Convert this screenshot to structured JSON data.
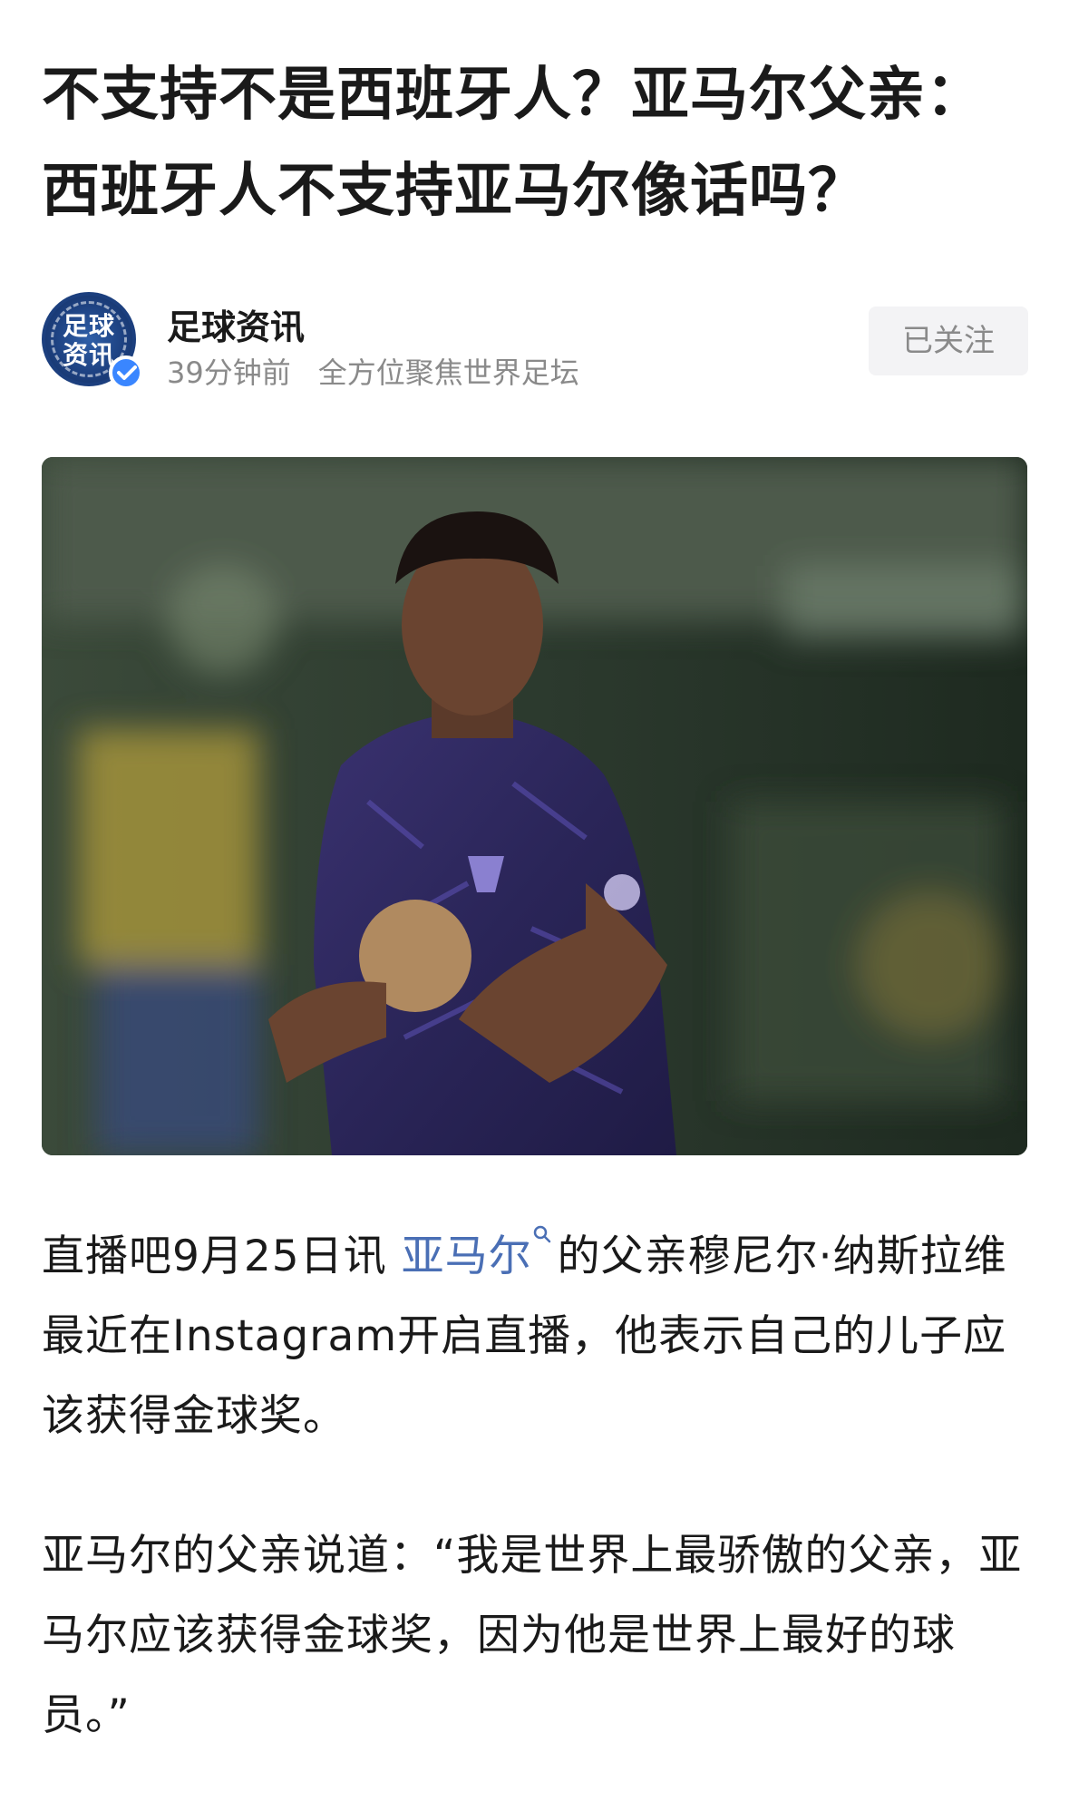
{
  "article": {
    "title": "不支持不是西班牙人？亚马尔父亲：西班牙人不支持亚马尔像话吗？"
  },
  "author": {
    "avatar_text_line1": "足球",
    "avatar_text_line2": "资讯",
    "name": "足球资讯",
    "time": "39分钟前",
    "description": "全方位聚焦世界足坛",
    "follow_label": "已关注"
  },
  "content": {
    "p1_before": "直播吧9月25日讯 ",
    "p1_link": "亚马尔",
    "p1_after": "的父亲穆尼尔·纳斯拉维最近在Instagram开启直播，他表示自己的儿子应该获得金球奖。",
    "p2": "亚马尔的父亲说道：“我是世界上最骄傲的父亲，亚马尔应该获得金球奖，因为他是世界上最好的球员。”"
  },
  "icons": {
    "verified": "verified-check-icon",
    "search": "search-icon"
  },
  "colors": {
    "link": "#4a6fb5",
    "verified": "#3a86ff",
    "avatar": "#1c3f7e"
  }
}
